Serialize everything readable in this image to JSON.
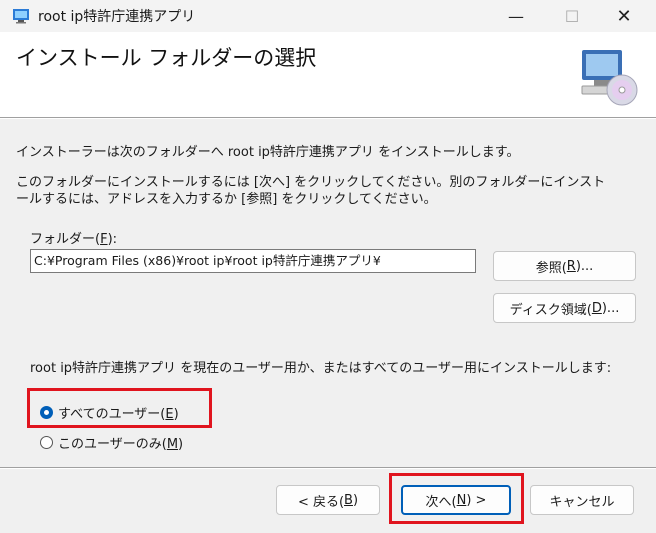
{
  "window": {
    "title": "root ip特許庁連携アプリ",
    "minimize": "—",
    "maximize": "☐",
    "close": "✕"
  },
  "header": {
    "title": "インストール フォルダーの選択",
    "icon": "computer-cd-icon"
  },
  "body": {
    "intro": "インストーラーは次のフォルダーへ root ip特許庁連携アプリ をインストールします。",
    "instruction_line1": "このフォルダーにインストールするには [次へ] をクリックしてください。別のフォルダーにインスト",
    "instruction_line2": "ールするには、アドレスを入力するか [参照] をクリックしてください。"
  },
  "folder": {
    "label": "フォルダー(",
    "label_key": "F",
    "label_end": "):",
    "value": "C:¥Program Files (x86)¥root ip¥root ip特許庁連携アプリ¥"
  },
  "buttons": {
    "browse": "参照(",
    "browse_key": "R",
    "browse_end": ")...",
    "disk": "ディスク領域(",
    "disk_key": "D",
    "disk_end": ")...",
    "back": "< 戻る(",
    "back_key": "B",
    "back_end": ")",
    "next": "次へ(",
    "next_key": "N",
    "next_end": ") >",
    "cancel": "キャンセル"
  },
  "install_scope": {
    "question": "root ip特許庁連携アプリ を現在のユーザー用か、またはすべてのユーザー用にインストールします:",
    "options": [
      {
        "label": "すべてのユーザー(",
        "key": "E",
        "end": ")",
        "selected": true
      },
      {
        "label": "このユーザーのみ(",
        "key": "M",
        "end": ")",
        "selected": false
      }
    ]
  },
  "colors": {
    "accent": "#005fb8",
    "highlight": "#e0141e"
  }
}
